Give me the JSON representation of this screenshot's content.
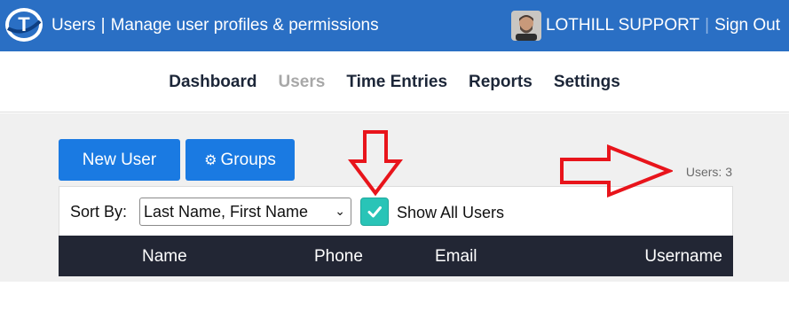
{
  "header": {
    "section": "Users",
    "subtitle": "Manage user profiles & permissions",
    "user_name": "LOTHILL SUPPORT",
    "sign_out": "Sign Out",
    "logo_letter": "T"
  },
  "nav": {
    "items": [
      "Dashboard",
      "Users",
      "Time Entries",
      "Reports",
      "Settings"
    ],
    "active": "Users"
  },
  "toolbar": {
    "new_user": "New User",
    "groups": "Groups",
    "user_count": "Users: 3"
  },
  "filters": {
    "sort_label": "Sort By:",
    "sort_value": "Last Name, First Name",
    "show_all_label": "Show All Users",
    "show_all_checked": true
  },
  "table": {
    "columns": [
      "Name",
      "Phone",
      "Email",
      "Username"
    ]
  },
  "colors": {
    "header_bg": "#2a6fc4",
    "button_blue": "#1a7ae2",
    "checkbox_teal": "#29c4b7",
    "table_header_bg": "#222634",
    "annotation_red": "#e8141b"
  }
}
